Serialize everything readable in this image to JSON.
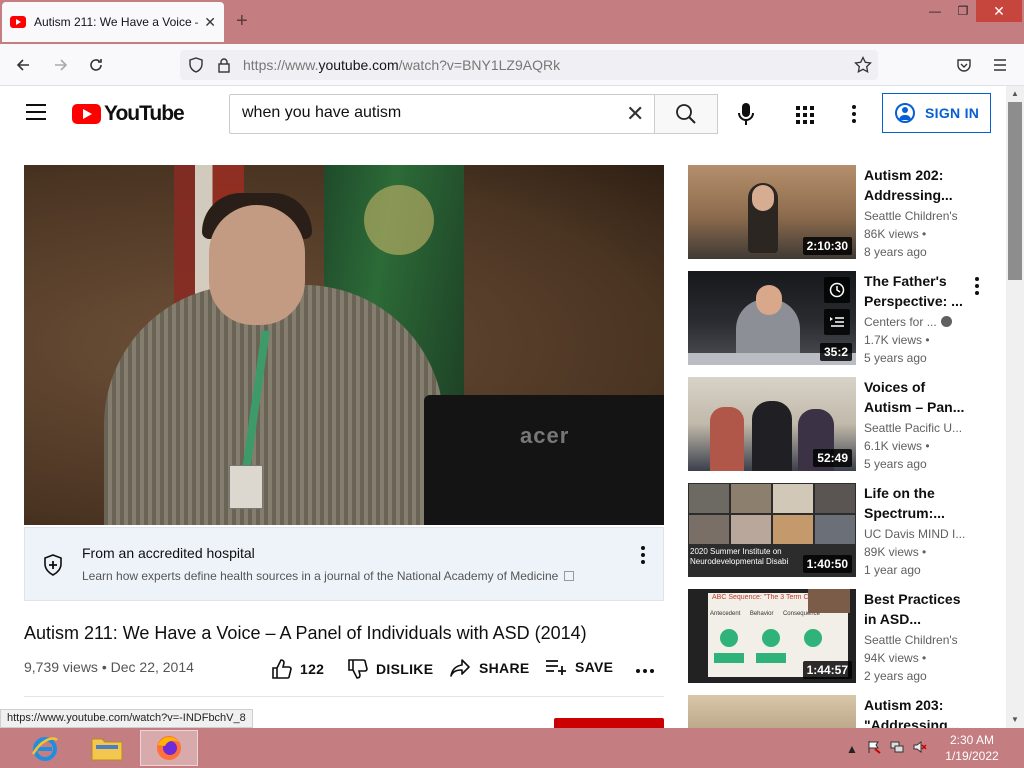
{
  "browser": {
    "tab_title": "Autism 211: We Have a Voice –",
    "new_tab_icon": "plus-icon",
    "url_prefix": "https://www.",
    "url_domain": "youtube.com",
    "url_path": "/watch?v=BNY1LZ9AQRk"
  },
  "youtube": {
    "logo_text": "YouTube",
    "search_value": "when you have autism",
    "sign_in_label": "SIGN IN"
  },
  "video": {
    "monitor_brand": "acer",
    "info_card": {
      "title": "From an accredited hospital",
      "subtitle": "Learn how experts define health sources in a journal of the National Academy of Medicine"
    },
    "title": "Autism 211: We Have a Voice – A Panel of Individuals with ASD (2014)",
    "views": "9,739 views",
    "separator": "•",
    "date": "Dec 22, 2014",
    "likes": "122",
    "dislike_label": "DISLIKE",
    "share_label": "SHARE",
    "save_label": "SAVE"
  },
  "recommendations": [
    {
      "title1": "Autism 202:",
      "title2": "Addressing...",
      "channel": "Seattle Children's",
      "views": "86K views •",
      "age": "8 years ago",
      "duration": "2:10:30"
    },
    {
      "title1": "The Father's",
      "title2": "Perspective: ...",
      "channel": "Centers for ...",
      "views": "1.7K views •",
      "age": "5 years ago",
      "duration": "35:2"
    },
    {
      "title1": "Voices of",
      "title2": "Autism – Pan...",
      "channel": "Seattle Pacific U...",
      "views": "6.1K views •",
      "age": "5 years ago",
      "duration": "52:49"
    },
    {
      "title1": "Life on the",
      "title2": "Spectrum:...",
      "channel": "UC Davis MIND I...",
      "views": "89K views •",
      "age": "1 year ago",
      "duration": "1:40:50",
      "thumb_caption": "2020 Summer Institute on Neurodevelopmental Disabi"
    },
    {
      "title1": "Best Practices",
      "title2": "in ASD...",
      "channel": "Seattle Children's",
      "views": "94K views •",
      "age": "2 years ago",
      "duration": "1:44:57",
      "thumb_caption": "ABC Sequence: \"The 3 Term Conti",
      "abc": [
        "Antecedent",
        "Behavior",
        "Consequence"
      ]
    },
    {
      "title1": "Autism 203:",
      "title2": "\"Addressing..."
    }
  ],
  "status_url": "https://www.youtube.com/watch?v=-INDFbchV_8",
  "taskbar": {
    "time": "2:30 AM",
    "date": "1/19/2022"
  }
}
